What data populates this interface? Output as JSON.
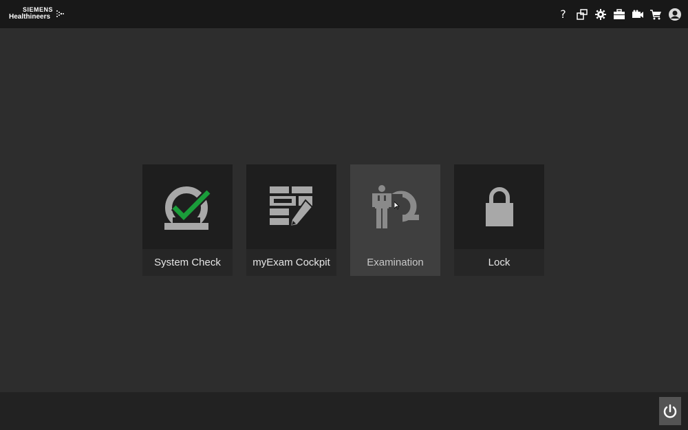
{
  "brand": {
    "line1": "SIEMENS",
    "line2": "Healthineers"
  },
  "topbar": {
    "icons": [
      "help-icon",
      "screens-icon",
      "gear-icon",
      "briefcase-icon",
      "camera-icon",
      "cart-icon",
      "user-icon"
    ],
    "help_glyph": "?"
  },
  "tiles": [
    {
      "label": "System Check",
      "icon": "system-check-icon",
      "active": false
    },
    {
      "label": "myExam Cockpit",
      "icon": "exam-cockpit-icon",
      "active": false
    },
    {
      "label": "Examination",
      "icon": "examination-icon",
      "active": true
    },
    {
      "label": "Lock",
      "icon": "lock-icon",
      "active": false
    }
  ],
  "colors": {
    "accent_green": "#1a9d3a",
    "icon_gray": "#a8a8a8",
    "tile_bg": "#1e1e1e",
    "tile_active_bg": "#3f3f3f"
  }
}
